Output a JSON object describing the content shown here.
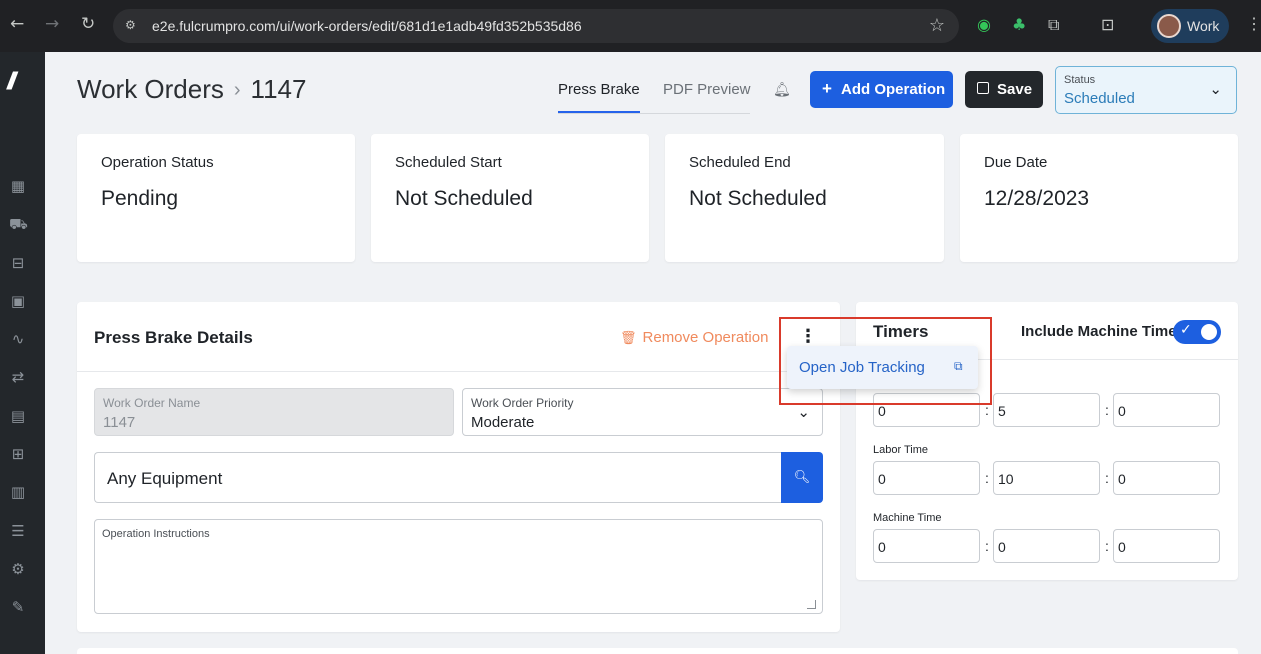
{
  "browser": {
    "url": "e2e.fulcrumpro.com/ui/work-orders/edit/681d1e1adb49fd352b535d86",
    "profile_label": "Work"
  },
  "header": {
    "breadcrumb_root": "Work Orders",
    "breadcrumb_current": "1147",
    "tabs": [
      {
        "label": "Press Brake",
        "active": true
      },
      {
        "label": "PDF Preview",
        "active": false
      }
    ],
    "add_operation_label": "Add Operation",
    "save_label": "Save",
    "status_caption": "Status",
    "status_value": "Scheduled"
  },
  "stats": [
    {
      "label": "Operation Status",
      "value": "Pending"
    },
    {
      "label": "Scheduled Start",
      "value": "Not Scheduled"
    },
    {
      "label": "Scheduled End",
      "value": "Not Scheduled"
    },
    {
      "label": "Due Date",
      "value": "12/28/2023"
    }
  ],
  "details": {
    "title": "Press Brake Details",
    "remove_label": "Remove Operation",
    "work_order_name_caption": "Work Order Name",
    "work_order_name_value": "1147",
    "priority_caption": "Work Order Priority",
    "priority_value": "Moderate",
    "equipment_value": "Any Equipment",
    "instructions_caption": "Operation Instructions"
  },
  "menu": {
    "item_label": "Open Job Tracking"
  },
  "timers": {
    "title": "Timers",
    "include_machine_time_label": "Include Machine Time",
    "include_machine_time": true,
    "rows": [
      {
        "label": "",
        "h": "0",
        "m": "5",
        "s": "0"
      },
      {
        "label": "Labor Time",
        "h": "0",
        "m": "10",
        "s": "0"
      },
      {
        "label": "Machine Time",
        "h": "0",
        "m": "0",
        "s": "0"
      }
    ]
  },
  "colors": {
    "accent": "#1d5fe0",
    "remove": "#f08a5d",
    "highlight": "#d93a2b"
  }
}
